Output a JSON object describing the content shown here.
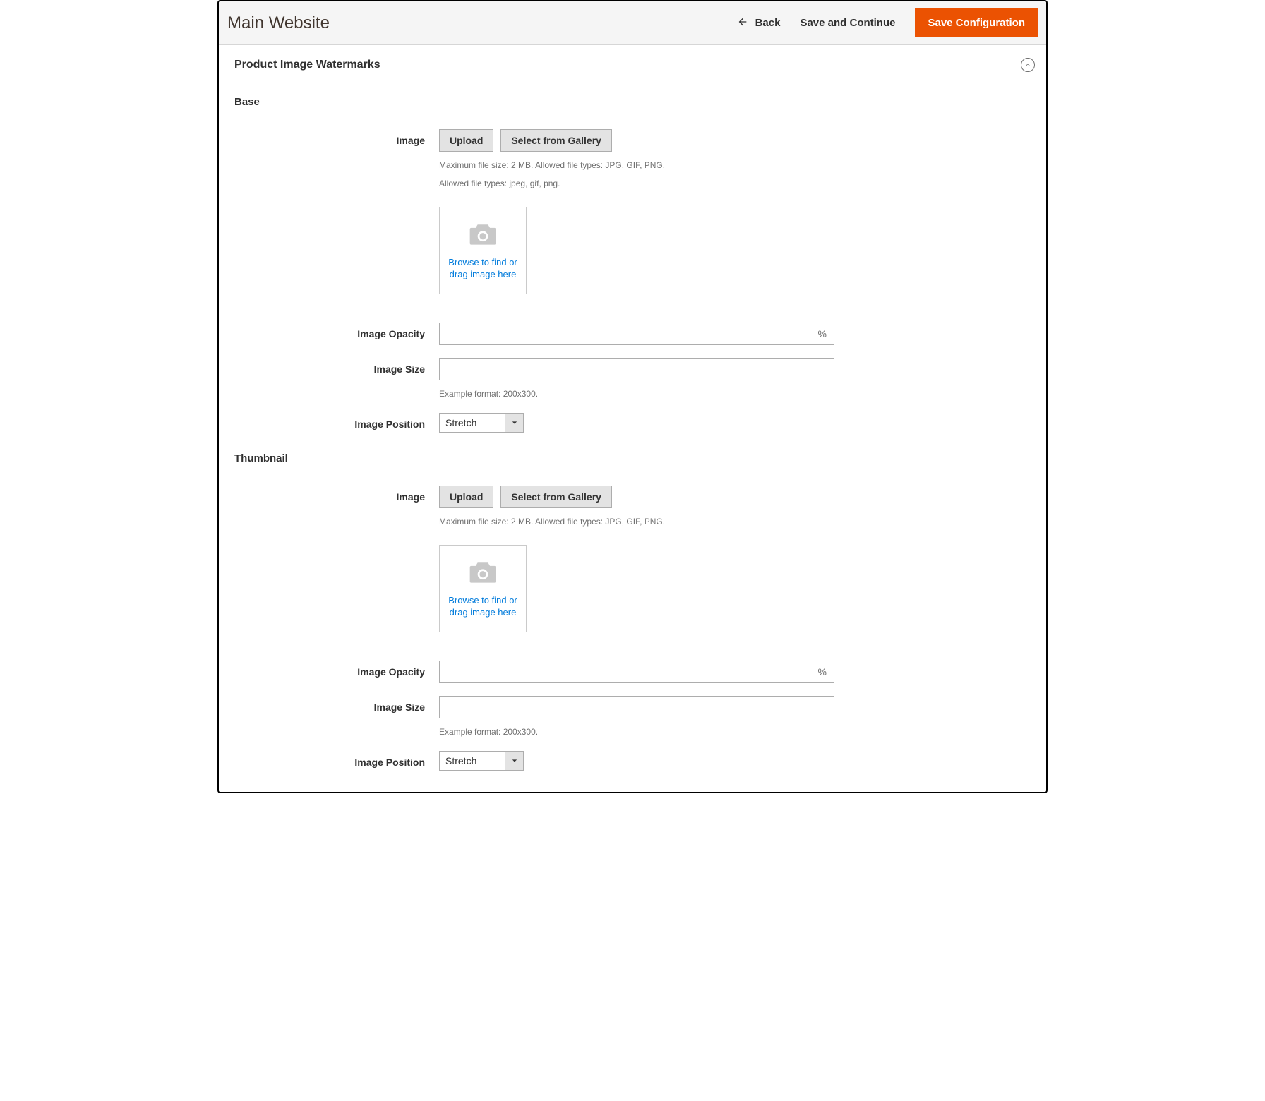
{
  "header": {
    "title": "Main Website",
    "back_label": "Back",
    "save_continue_label": "Save and Continue",
    "save_config_label": "Save Configuration"
  },
  "section": {
    "title": "Product Image Watermarks"
  },
  "groups": {
    "base": {
      "title": "Base",
      "image_label": "Image",
      "upload_label": "Upload",
      "gallery_label": "Select from Gallery",
      "note1": "Maximum file size: 2 MB. Allowed file types: JPG, GIF, PNG.",
      "note2": "Allowed file types: jpeg, gif, png.",
      "browse_text": "Browse to find or drag image here",
      "opacity_label": "Image Opacity",
      "opacity_value": "",
      "opacity_unit": "%",
      "size_label": "Image Size",
      "size_value": "",
      "size_note": "Example format: 200x300.",
      "position_label": "Image Position",
      "position_value": "Stretch"
    },
    "thumbnail": {
      "title": "Thumbnail",
      "image_label": "Image",
      "upload_label": "Upload",
      "gallery_label": "Select from Gallery",
      "note1": "Maximum file size: 2 MB. Allowed file types: JPG, GIF, PNG.",
      "browse_text": "Browse to find or drag image here",
      "opacity_label": "Image Opacity",
      "opacity_value": "",
      "opacity_unit": "%",
      "size_label": "Image Size",
      "size_value": "",
      "size_note": "Example format: 200x300.",
      "position_label": "Image Position",
      "position_value": "Stretch"
    }
  }
}
